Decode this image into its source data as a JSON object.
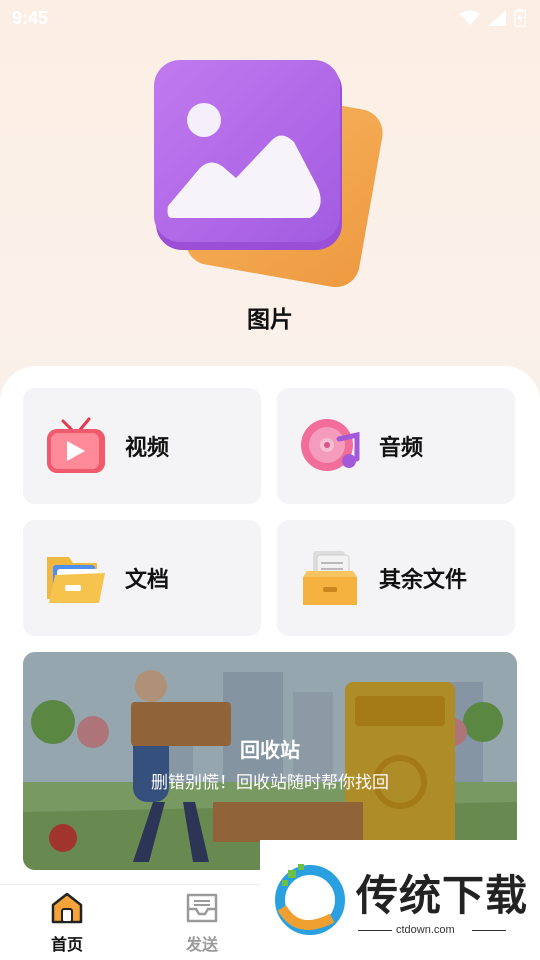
{
  "status_bar": {
    "time": "9:45"
  },
  "hero": {
    "title": "图片"
  },
  "tiles": [
    {
      "label": "视频",
      "icon": "tv-play-icon"
    },
    {
      "label": "音频",
      "icon": "music-disc-icon"
    },
    {
      "label": "文档",
      "icon": "folder-icon"
    },
    {
      "label": "其余文件",
      "icon": "file-box-icon"
    }
  ],
  "banner": {
    "title": "回收站",
    "subtitle": "删错别慌！回收站随时帮你找回"
  },
  "tabbar": {
    "items": [
      {
        "label": "首页",
        "icon": "home-icon",
        "active": true
      },
      {
        "label": "发送",
        "icon": "inbox-tray-icon",
        "active": false
      }
    ]
  },
  "watermark": {
    "brand": "传统下载",
    "url": "ctdown.com"
  },
  "colors": {
    "accent_purple": "#b36ae8",
    "accent_orange": "#f0a04a",
    "tile_bg": "#f4f4f6",
    "active_tab": "#111111",
    "inactive_tab": "#9a9a9a"
  }
}
